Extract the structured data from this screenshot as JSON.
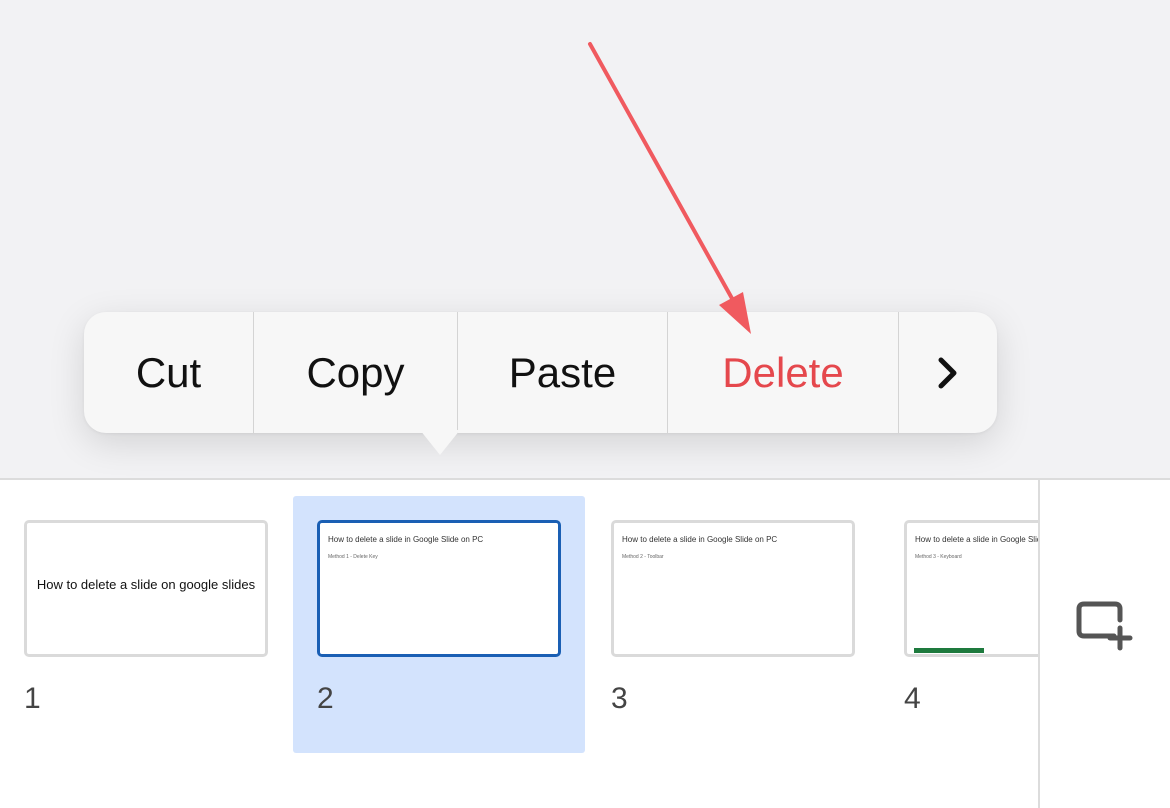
{
  "context_menu": {
    "items": [
      {
        "label": "Cut"
      },
      {
        "label": "Copy"
      },
      {
        "label": "Paste"
      },
      {
        "label": "Delete"
      },
      {
        "label": "›",
        "icon": "chevron-right-icon"
      }
    ]
  },
  "filmstrip": {
    "slides": [
      {
        "number": "1",
        "title": "How to delete a slide on google slides",
        "subtitle": "",
        "selected": false
      },
      {
        "number": "2",
        "title": "How to delete a slide in Google Slide on PC",
        "subtitle": "Method 1 - Delete Key",
        "selected": true
      },
      {
        "number": "3",
        "title": "How to delete a slide in Google Slide on PC",
        "subtitle": "Method 2 - Toolbar",
        "selected": false
      },
      {
        "number": "4",
        "title": "How to delete a slide in Google Slide on PC",
        "subtitle": "Method 3 - Keyboard",
        "selected": false
      }
    ],
    "new_slide_icon": "add-slide-icon"
  },
  "annotation": {
    "arrow_color": "#f05a5f",
    "arrow_icon": "pointer-arrow"
  },
  "colors": {
    "danger": "#e5484d",
    "selection": "#d3e3fd",
    "selected_border": "#1a5fb4"
  }
}
